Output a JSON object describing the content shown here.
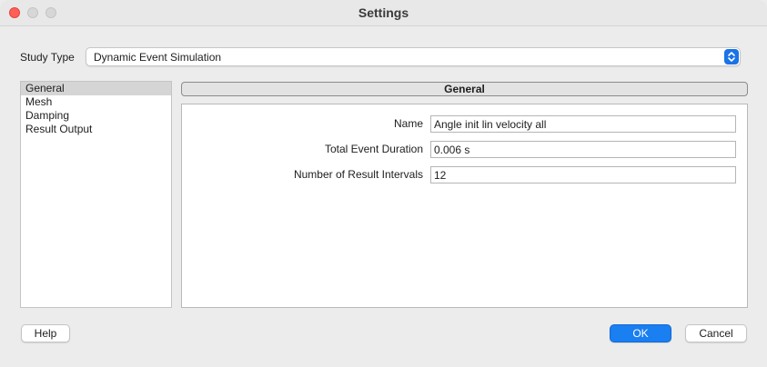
{
  "window": {
    "title": "Settings"
  },
  "study_type": {
    "label": "Study Type",
    "selected": "Dynamic Event Simulation"
  },
  "nav": {
    "items": [
      {
        "label": "General",
        "selected": true
      },
      {
        "label": "Mesh",
        "selected": false
      },
      {
        "label": "Damping",
        "selected": false
      },
      {
        "label": "Result Output",
        "selected": false
      }
    ]
  },
  "general": {
    "header": "General",
    "fields": [
      {
        "label": "Name",
        "value": "Angle init lin velocity all"
      },
      {
        "label": "Total Event Duration",
        "value": "0.006 s"
      },
      {
        "label": "Number of Result Intervals",
        "value": "12"
      }
    ]
  },
  "buttons": {
    "help": "Help",
    "ok": "OK",
    "cancel": "Cancel"
  },
  "colors": {
    "accent": "#1a7ff0",
    "close": "#ff5f57",
    "selection": "#d5d5d5"
  },
  "icons": {
    "close": "close-icon",
    "minimize": "minimize-icon",
    "zoom": "zoom-icon",
    "select_arrows": "up-down-chevron-icon"
  }
}
